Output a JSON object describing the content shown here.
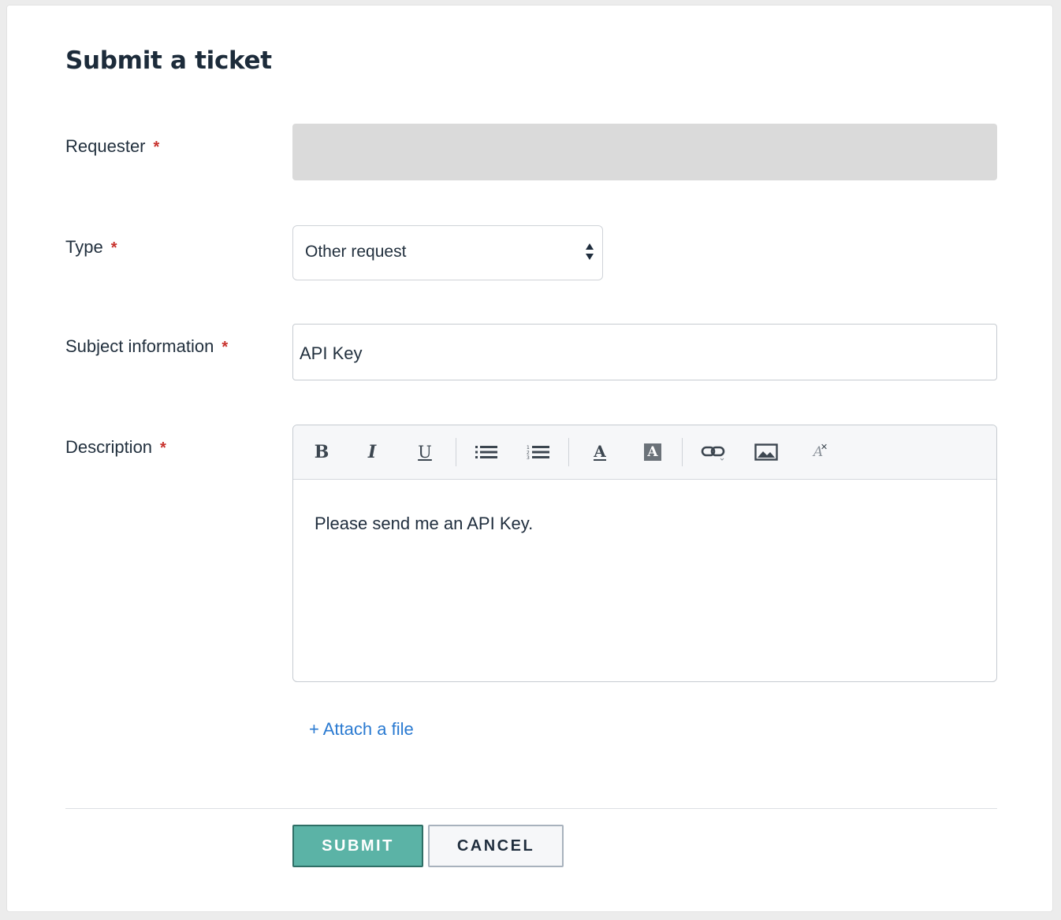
{
  "page": {
    "title": "Submit a ticket"
  },
  "form": {
    "required_marker": "*",
    "requester": {
      "label": "Requester",
      "value": ""
    },
    "type": {
      "label": "Type",
      "selected": "Other request"
    },
    "subject": {
      "label": "Subject information",
      "value": "API Key"
    },
    "description": {
      "label": "Description",
      "body": "Please send me an API Key.",
      "toolbar": [
        {
          "name": "bold-icon",
          "glyph": "B"
        },
        {
          "name": "italic-icon",
          "glyph": "I"
        },
        {
          "name": "underline-icon",
          "glyph": "U"
        },
        {
          "name": "bulleted-list-icon"
        },
        {
          "name": "numbered-list-icon"
        },
        {
          "name": "text-color-icon",
          "glyph": "A"
        },
        {
          "name": "background-color-icon",
          "glyph": "A"
        },
        {
          "name": "link-icon"
        },
        {
          "name": "image-icon"
        },
        {
          "name": "clear-formatting-icon",
          "glyph": "A"
        }
      ]
    },
    "attach_label": "+ Attach a file"
  },
  "actions": {
    "submit_label": "SUBMIT",
    "cancel_label": "CANCEL"
  },
  "colors": {
    "required": "#c8322d",
    "link": "#2a7ad1",
    "submit_bg": "#5bb3a6",
    "submit_border": "#2f6f66",
    "disabled_input": "#dadada"
  }
}
